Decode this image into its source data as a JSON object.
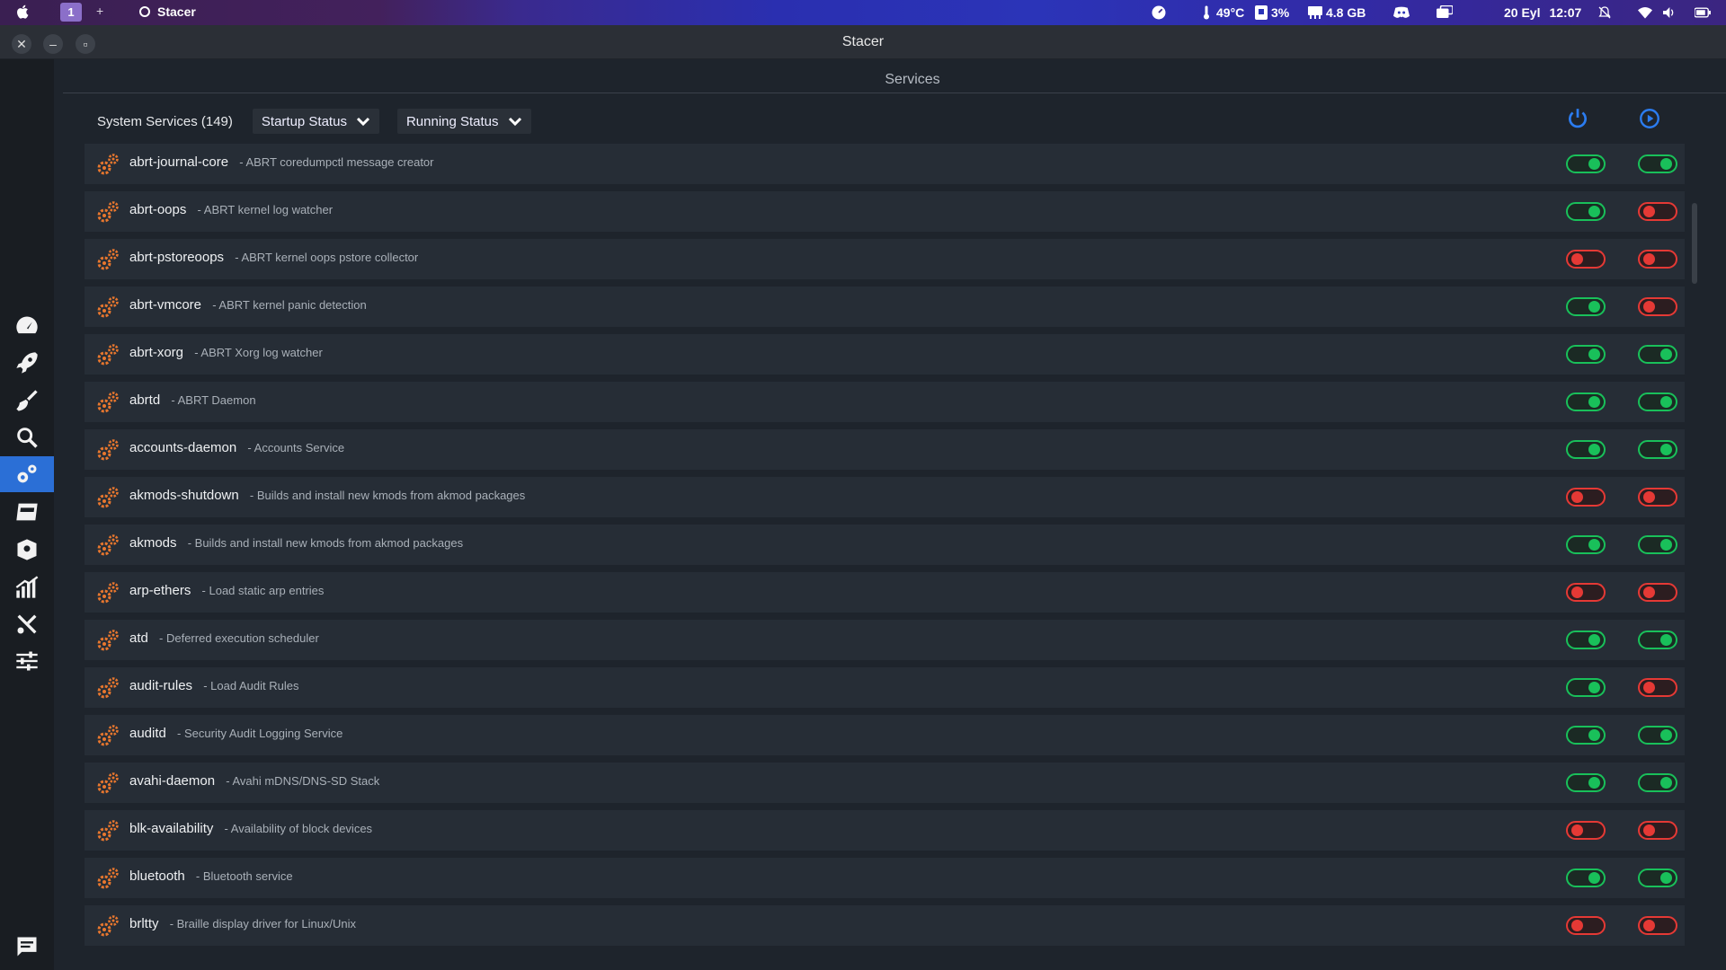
{
  "topbar": {
    "workspace": "1",
    "app_name": "Stacer",
    "temperature": "49°C",
    "cpu": "3%",
    "memory": "4.8 GB",
    "date": "20 Eyl",
    "time": "12:07"
  },
  "window": {
    "title": "Stacer"
  },
  "page": {
    "title": "Services",
    "system_services_label": "System Services (149)",
    "startup_status_label": "Startup Status",
    "running_status_label": "Running Status"
  },
  "sidebar": {
    "items": [
      {
        "name": "dashboard-icon"
      },
      {
        "name": "startup-apps-icon"
      },
      {
        "name": "system-cleaner-icon"
      },
      {
        "name": "search-icon"
      },
      {
        "name": "services-icon",
        "active": true
      },
      {
        "name": "uninstaller-icon"
      },
      {
        "name": "resources-icon"
      },
      {
        "name": "apt-repository-icon"
      },
      {
        "name": "gnome-settings-icon"
      },
      {
        "name": "settings-icon"
      },
      {
        "name": "feedback-icon"
      }
    ]
  },
  "colors": {
    "on": "#19c05a",
    "off": "#e53935",
    "accent": "#2b6fd6",
    "gear": "#e8772e"
  },
  "services": [
    {
      "name": "abrt-journal-core",
      "desc": "- ABRT coredumpctl message creator",
      "startup": true,
      "running": true
    },
    {
      "name": "abrt-oops",
      "desc": "- ABRT kernel log watcher",
      "startup": true,
      "running": false
    },
    {
      "name": "abrt-pstoreoops",
      "desc": "- ABRT kernel oops pstore collector",
      "startup": false,
      "running": false
    },
    {
      "name": "abrt-vmcore",
      "desc": "- ABRT kernel panic detection",
      "startup": true,
      "running": false
    },
    {
      "name": "abrt-xorg",
      "desc": "- ABRT Xorg log watcher",
      "startup": true,
      "running": true
    },
    {
      "name": "abrtd",
      "desc": "- ABRT Daemon",
      "startup": true,
      "running": true
    },
    {
      "name": "accounts-daemon",
      "desc": "- Accounts Service",
      "startup": true,
      "running": true
    },
    {
      "name": "akmods-shutdown",
      "desc": "- Builds and install new kmods from akmod packages",
      "startup": false,
      "running": false
    },
    {
      "name": "akmods",
      "desc": "- Builds and install new kmods from akmod packages",
      "startup": true,
      "running": true
    },
    {
      "name": "arp-ethers",
      "desc": "- Load static arp entries",
      "startup": false,
      "running": false
    },
    {
      "name": "atd",
      "desc": "- Deferred execution scheduler",
      "startup": true,
      "running": true
    },
    {
      "name": "audit-rules",
      "desc": "- Load Audit Rules",
      "startup": true,
      "running": false
    },
    {
      "name": "auditd",
      "desc": "- Security Audit Logging Service",
      "startup": true,
      "running": true
    },
    {
      "name": "avahi-daemon",
      "desc": "- Avahi mDNS/DNS-SD Stack",
      "startup": true,
      "running": true
    },
    {
      "name": "blk-availability",
      "desc": "- Availability of block devices",
      "startup": false,
      "running": false
    },
    {
      "name": "bluetooth",
      "desc": "- Bluetooth service",
      "startup": true,
      "running": true
    },
    {
      "name": "brltty",
      "desc": "- Braille display driver for Linux/Unix",
      "startup": false,
      "running": false
    }
  ]
}
